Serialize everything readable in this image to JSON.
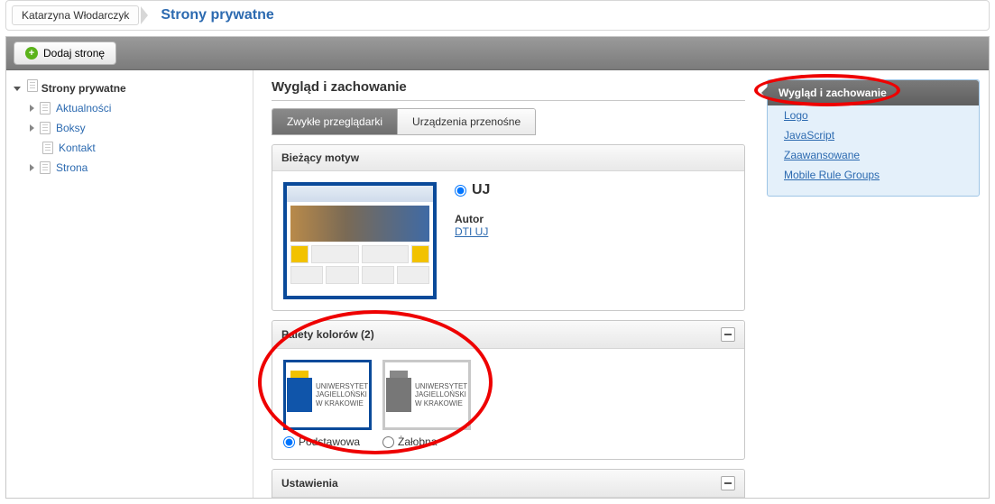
{
  "breadcrumb": {
    "user": "Katarzyna Włodarczyk",
    "page": "Strony prywatne"
  },
  "toolbar": {
    "add_page": "Dodaj stronę"
  },
  "tree": {
    "root": "Strony prywatne",
    "items": [
      {
        "label": "Aktualności",
        "expandable": true
      },
      {
        "label": "Boksy",
        "expandable": true
      },
      {
        "label": "Kontakt",
        "expandable": false
      },
      {
        "label": "Strona",
        "expandable": true
      }
    ]
  },
  "section_title": "Wygląd i zachowanie",
  "tabs": {
    "browsers": "Zwykłe przeglądarki",
    "mobile": "Urządzenia przenośne"
  },
  "current_theme": {
    "header": "Bieżący motyw",
    "name": "UJ",
    "author_label": "Autor",
    "author": "DTI UJ"
  },
  "palettes": {
    "header": "Palety kolorów (2)",
    "logo_text": "UNIWERSYTET JAGIELLOŃSKI W KRAKOWIE",
    "items": [
      {
        "label": "Podstawowa",
        "selected": true,
        "color": true
      },
      {
        "label": "Żałobna",
        "selected": false,
        "color": false
      }
    ]
  },
  "settings": {
    "header": "Ustawienia"
  },
  "right_nav": {
    "header": "Wygląd i zachowanie",
    "links": {
      "logo": "Logo",
      "js": "JavaScript",
      "advanced": "Zaawansowane",
      "mobile": "Mobile Rule Groups"
    }
  }
}
